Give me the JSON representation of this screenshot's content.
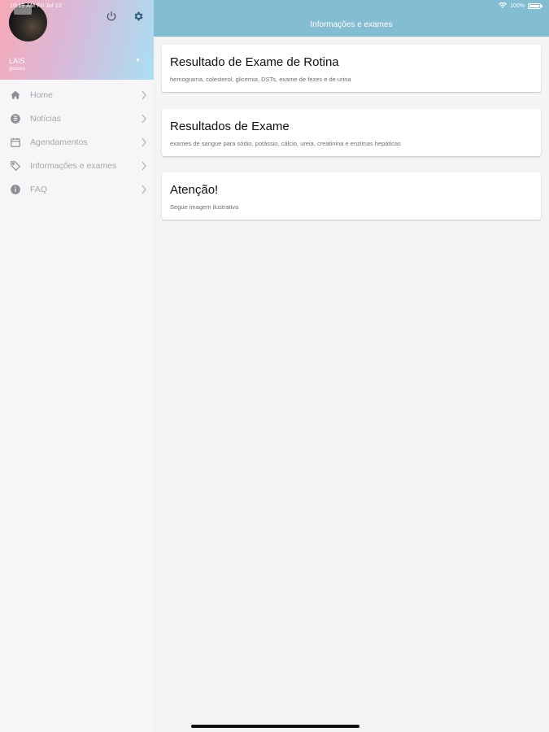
{
  "status_bar": {
    "time": "10:19 AM   Fri Jul 12",
    "battery": "100%"
  },
  "sidebar": {
    "user": {
      "name": "LAIS",
      "role": "gestora"
    },
    "icons": {
      "power": "power-icon",
      "settings": "gear-icon"
    },
    "items": [
      {
        "label": "Home",
        "icon": "home-icon"
      },
      {
        "label": "Notícias",
        "icon": "news-icon"
      },
      {
        "label": "Agendamentos",
        "icon": "calendar-icon"
      },
      {
        "label": "Informações e exames",
        "icon": "tag-icon"
      },
      {
        "label": "FAQ",
        "icon": "info-icon"
      }
    ]
  },
  "header": {
    "title": "Informações e exames"
  },
  "cards": [
    {
      "title": "Resultado de Exame de Rotina",
      "subtitle": "hemograma, colesterol, glicemia, DSTs, exame de fezes e de urina"
    },
    {
      "title": "Resultados de Exame",
      "subtitle": "exames de sangue para sódio, potássio, cálcio, ureia, creatinina e enzimas hepáticas"
    },
    {
      "title": "Atenção!",
      "subtitle": "Segue imagem ilustrativa"
    }
  ],
  "colors": {
    "topbar": "#84bdd1",
    "gradient_start": "#f6a9b7",
    "gradient_end": "#a9dff2",
    "icon_gray": "#8e8e93"
  }
}
